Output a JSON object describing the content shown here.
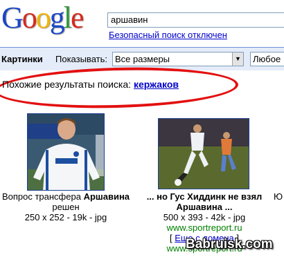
{
  "logo": {
    "letters": [
      "G",
      "o",
      "o",
      "g",
      "l",
      "e"
    ],
    "colors": [
      "#1b47c6",
      "#d62a1e",
      "#f0b400",
      "#1b47c6",
      "#2f9a3a",
      "#d62a1e"
    ]
  },
  "search": {
    "query": "аршавин",
    "safe_search_label": "Безопасный поиск отключен"
  },
  "toolbar": {
    "title": "Картинки",
    "show_label": "Показывать:",
    "size_select": "Все размеры",
    "type_select": "Любое"
  },
  "related": {
    "label": "Похожие результаты поиска:",
    "link": "кержаков"
  },
  "results": [
    {
      "line1_prefix": "Вопрос трансфера ",
      "line1_bold": "Аршавина",
      "line2": "решен",
      "meta": "250 x 252 - 19k - jpg"
    },
    {
      "line1_prefix": "... но Гус Хиддинк не взял",
      "line2_bold": "Аршавина ...",
      "meta": "500 x 393 - 42k - jpg",
      "site": "www.sportreport.ru",
      "similar_link": "Еще с домена",
      "site2": "www.sportreport.ru"
    },
    {
      "partial": "Ю"
    }
  ],
  "watermark": "Babruisk.com"
}
